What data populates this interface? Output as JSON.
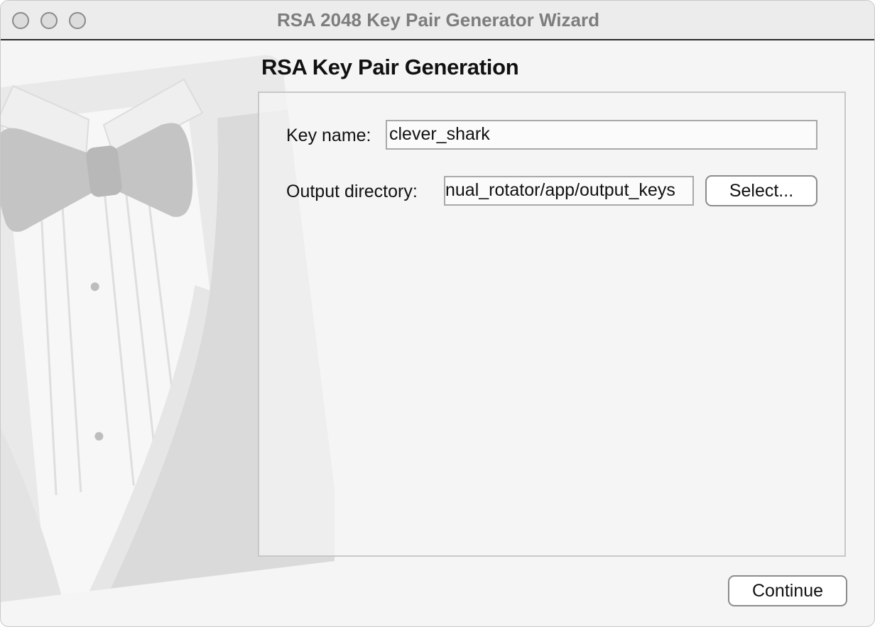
{
  "window": {
    "title": "RSA 2048 Key Pair Generator Wizard"
  },
  "page": {
    "heading": "RSA Key Pair Generation"
  },
  "form": {
    "key_name_label": "Key name:",
    "key_name_value": "clever_shark",
    "output_dir_label": "Output directory:",
    "output_dir_value": "nual_rotator/app/output_keys",
    "select_button": "Select..."
  },
  "footer": {
    "continue_button": "Continue"
  },
  "icons": {
    "background_art": "tuxedo-bowtie-icon",
    "close": "close-traffic-light-icon",
    "minimize": "minimize-traffic-light-icon",
    "zoom": "zoom-traffic-light-icon"
  }
}
